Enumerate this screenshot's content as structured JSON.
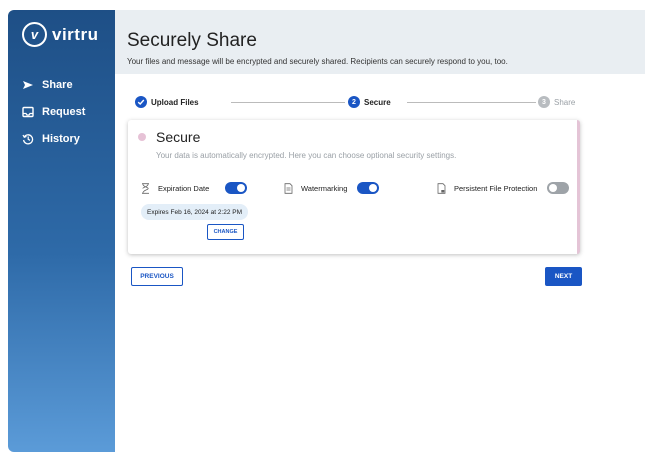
{
  "app": {
    "logo_mark": "v",
    "logo_text": "virtru"
  },
  "sidebar": {
    "items": [
      {
        "label": "Share",
        "icon": "send-icon"
      },
      {
        "label": "Request",
        "icon": "inbox-icon"
      },
      {
        "label": "History",
        "icon": "history-icon"
      }
    ]
  },
  "header": {
    "title": "Securely Share",
    "subtitle": "Your files and message will be encrypted and securely shared. Recipients can securely respond to you, too."
  },
  "stepper": {
    "steps": [
      {
        "number": "",
        "label": "Upload Files",
        "state": "complete"
      },
      {
        "number": "2",
        "label": "Secure",
        "state": "active"
      },
      {
        "number": "3",
        "label": "Share",
        "state": "pending"
      }
    ]
  },
  "secure_card": {
    "title": "Secure",
    "description": "Your data is automatically encrypted. Here you can choose optional security settings.",
    "options": [
      {
        "label": "Expiration Date",
        "enabled": true,
        "icon": "hourglass-icon"
      },
      {
        "label": "Watermarking",
        "enabled": true,
        "icon": "document-icon"
      },
      {
        "label": "Persistent File Protection",
        "enabled": false,
        "icon": "file-lock-icon"
      }
    ],
    "expires_text": "Expires Feb 16, 2024 at 2:22 PM",
    "change_label": "CHANGE"
  },
  "actions": {
    "previous_label": "PREVIOUS",
    "next_label": "NEXT"
  },
  "colors": {
    "accent": "#1a56c4",
    "sidebar_top": "#1e4f86",
    "sidebar_bottom": "#5b9bd8",
    "header_bg": "#e9eef2",
    "secure_dot": "#e6c2d6",
    "toggle_off": "#9ea3a8"
  }
}
